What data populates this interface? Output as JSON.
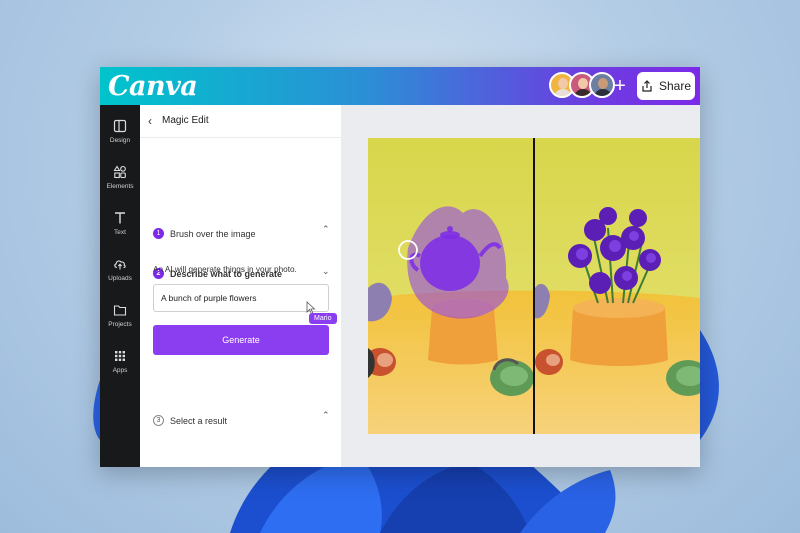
{
  "app": {
    "logo": "Canva",
    "share_label": "Share",
    "add_label": "+"
  },
  "colors": {
    "accent": "#8b3df0",
    "rail": "#18191b",
    "gradient_start": "#00c4cc",
    "gradient_end": "#7d2ae8"
  },
  "sidebar": {
    "items": [
      {
        "label": "Design",
        "icon": "layout-icon"
      },
      {
        "label": "Elements",
        "icon": "shapes-icon"
      },
      {
        "label": "Text",
        "icon": "text-icon"
      },
      {
        "label": "Uploads",
        "icon": "cloud-upload-icon"
      },
      {
        "label": "Projects",
        "icon": "folder-icon"
      },
      {
        "label": "Apps",
        "icon": "grid-icon"
      }
    ]
  },
  "panel": {
    "title": "Magic Edit",
    "steps": [
      {
        "number": "1",
        "label": "Brush over the image"
      },
      {
        "number": "2",
        "label": "Describe what to generate"
      },
      {
        "number": "3",
        "label": "Select a result"
      }
    ],
    "hint": "An AI will generate things in your photo.",
    "prompt_value": "A bunch of purple flowers",
    "generate_label": "Generate",
    "cursor_tag": "Mario"
  }
}
